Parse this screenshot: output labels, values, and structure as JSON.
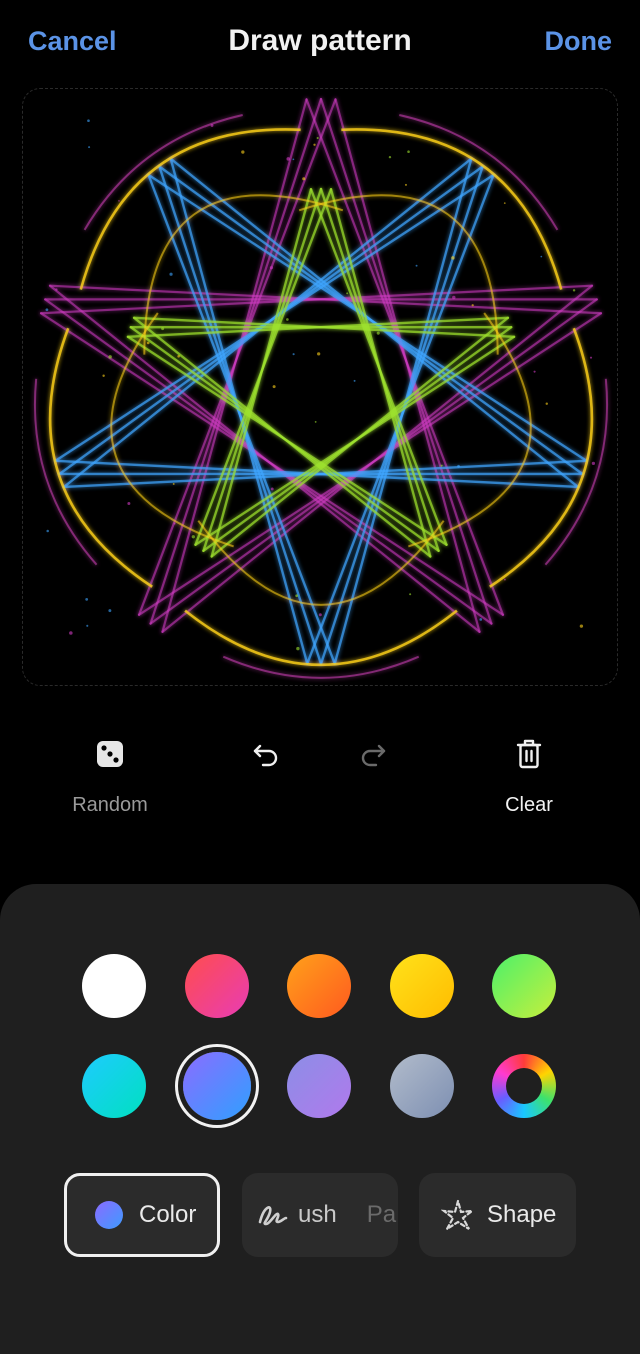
{
  "header": {
    "cancel": "Cancel",
    "title": "Draw pattern",
    "done": "Done"
  },
  "tools": {
    "random": {
      "label": "Random",
      "icon": "dice-icon"
    },
    "undo": {
      "icon": "undo-icon"
    },
    "redo": {
      "icon": "redo-icon"
    },
    "clear": {
      "label": "Clear",
      "icon": "trash-icon"
    }
  },
  "palette": {
    "row1": [
      {
        "name": "white",
        "colors": [
          "#ffffff",
          "#ffffff"
        ]
      },
      {
        "name": "red-pink",
        "colors": [
          "#ff4d4d",
          "#e83cb5"
        ]
      },
      {
        "name": "orange",
        "colors": [
          "#ffa11a",
          "#ff5a1f"
        ]
      },
      {
        "name": "yellow",
        "colors": [
          "#ffe21a",
          "#ffbc00"
        ]
      },
      {
        "name": "green",
        "colors": [
          "#4cf06a",
          "#c7ef3c"
        ]
      }
    ],
    "row2": [
      {
        "name": "cyan",
        "colors": [
          "#1ecbff",
          "#00e0c0"
        ]
      },
      {
        "name": "blue-violet",
        "colors": [
          "#8b6cff",
          "#2fa0ff"
        ],
        "selected": true
      },
      {
        "name": "lavender",
        "colors": [
          "#8c8ee6",
          "#b079ec"
        ]
      },
      {
        "name": "grey-blue",
        "colors": [
          "#b2bccb",
          "#7d8fb2"
        ]
      },
      {
        "name": "rainbow",
        "colors": [
          "rainbow"
        ]
      }
    ]
  },
  "modes": {
    "color": {
      "label": "Color"
    },
    "brush": {
      "label": "ush",
      "next_label": "Pa"
    },
    "shape": {
      "label": "Shape"
    }
  }
}
